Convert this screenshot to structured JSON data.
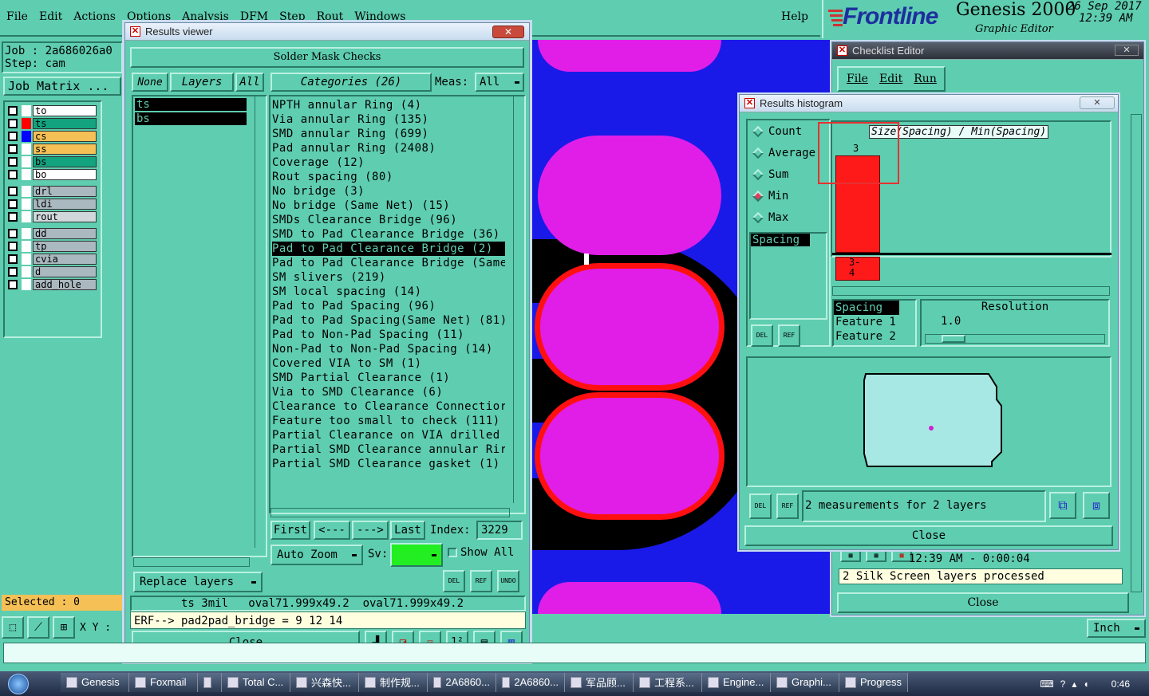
{
  "menubar": {
    "items": [
      "File",
      "Edit",
      "Actions",
      "Options",
      "Analysis",
      "DFM",
      "Step",
      "Rout",
      "Windows"
    ],
    "help": "Help"
  },
  "branding": {
    "logo": "Frontline",
    "product": "Genesis 2000",
    "subtitle": "Graphic Editor",
    "date": "26 Sep 2017",
    "time": "12:39 AM"
  },
  "job": {
    "job_label": "Job : 2a686026a0",
    "step_label": "Step: cam",
    "matrix_button": "Job Matrix ..."
  },
  "layers": [
    {
      "name": "to",
      "color": "#ffffff",
      "mark": "#ffffff"
    },
    {
      "name": "ts",
      "color": "#13a37f",
      "mark": "#ff0000"
    },
    {
      "name": "cs",
      "color": "#f5c055",
      "mark": "#0000ff"
    },
    {
      "name": "ss",
      "color": "#f5c055",
      "mark": "#ffffff"
    },
    {
      "name": "bs",
      "color": "#13a37f",
      "mark": "#ffffff"
    },
    {
      "name": "bo",
      "color": "#ffffff",
      "mark": "#ffffff"
    },
    {
      "name": "drl",
      "color": "#aab8c0",
      "mark": "#ffffff"
    },
    {
      "name": "ldi",
      "color": "#aab8c0",
      "mark": "#ffffff"
    },
    {
      "name": "rout",
      "color": "#d0d8dc",
      "mark": "#ffffff"
    },
    {
      "name": "dd",
      "color": "#aab8c0",
      "mark": "#ffffff"
    },
    {
      "name": "tp",
      "color": "#aab8c0",
      "mark": "#ffffff"
    },
    {
      "name": "cvia",
      "color": "#aab8c0",
      "mark": "#ffffff"
    },
    {
      "name": "d",
      "color": "#aab8c0",
      "mark": "#ffffff"
    },
    {
      "name": "add_hole",
      "color": "#aab8c0",
      "mark": "#ffffff"
    }
  ],
  "selected": "Selected : 0",
  "coords": {
    "xy_label": "X Y :"
  },
  "results_viewer": {
    "title": "Results viewer",
    "heading": "Solder Mask Checks",
    "none_btn": "None",
    "layers_btn": "Layers",
    "all_btn": "All",
    "layer_list": [
      "ts",
      "bs"
    ],
    "categories_label": "Categories (26)",
    "meas_label": "Meas:",
    "meas_value": "All",
    "categories": [
      "NPTH annular Ring (4)",
      "Via annular Ring (135)",
      "SMD annular Ring (699)",
      "Pad annular Ring (2408)",
      "Coverage (12)",
      "Rout spacing (80)",
      "No bridge (3)",
      "No bridge (Same Net) (15)",
      "SMDs Clearance Bridge (96)",
      "SMD to Pad Clearance Bridge (36)",
      "Pad to Pad Clearance Bridge (2)",
      "Pad to Pad Clearance Bridge (Same",
      "SM slivers (219)",
      "SM local spacing (14)",
      "Pad to Pad Spacing (96)",
      "Pad to Pad Spacing(Same Net) (81)",
      "Pad to Non-Pad Spacing (11)",
      "Non-Pad to Non-Pad Spacing (14)",
      "Covered VIA to SM (1)",
      "SMD Partial Clearance (1)",
      "Via to SMD Clearance (6)",
      "Clearance to Clearance Connectior",
      "Feature too small to check (111)",
      "Partial Clearance on VIA drilled",
      "Partial SMD Clearance annular Rir",
      "Partial SMD Clearance gasket (1)"
    ],
    "selected_category_index": 10,
    "nav": {
      "first": "First",
      "prev": "<---",
      "next": "--->",
      "last": "Last",
      "index_label": "Index:",
      "index_value": "3229"
    },
    "auto_zoom": "Auto Zoom",
    "sv_label": "Sv:",
    "show_all": "Show All",
    "replace_layers": "Replace layers",
    "status1": "ts 3mil   oval71.999x49.2  oval71.999x49.2",
    "status2": "ERF--> pad2pad_bridge = 9 12 14",
    "close": "Close",
    "del": "DEL",
    "ref": "REF",
    "undo": "UNDO"
  },
  "histogram": {
    "title": "Results histogram",
    "modes": [
      "Count",
      "Average",
      "Sum",
      "Min",
      "Max"
    ],
    "selected_mode": "Min",
    "chart_title": "Size(Spacing) / Min(Spacing)",
    "bar_value": "3",
    "bar_range": "3-\n4",
    "list_item": "Spacing",
    "features": [
      "Spacing",
      "Feature 1",
      "Feature 2"
    ],
    "resolution_label": "Resolution",
    "resolution_value": "1.0",
    "measurements": "2 measurements for 2 layers",
    "close": "Close",
    "del": "DEL",
    "ref": "REF"
  },
  "checklist": {
    "title": "Checklist Editor",
    "menu": [
      "File",
      "Edit",
      "Run"
    ],
    "status_time": "12:39 AM - 0:00:04",
    "status_text": "2 Silk Screen layers processed",
    "close": "Close"
  },
  "units": "Inch",
  "taskbar": {
    "items": [
      "Genesis",
      "Foxmail",
      "",
      "Total C...",
      "兴森快...",
      "制作规...",
      "2A6860...",
      "2A6860...",
      "军品顾...",
      "工程系...",
      "Engine...",
      "Graphi...",
      "Progress"
    ],
    "clock": "0:46"
  }
}
